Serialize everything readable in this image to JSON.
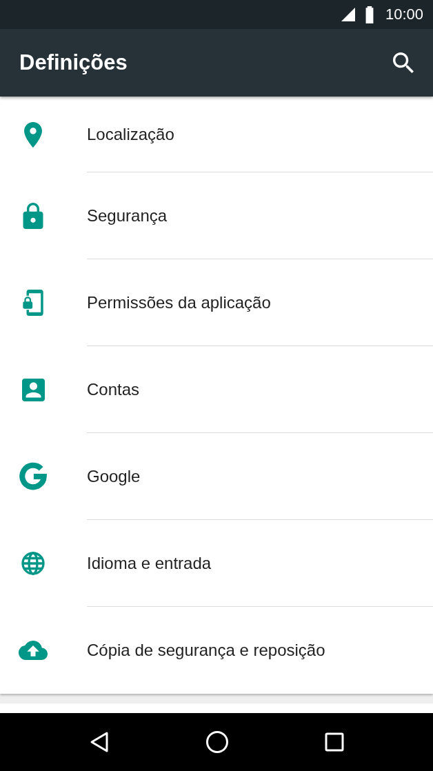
{
  "status_bar": {
    "time": "10:00"
  },
  "app_bar": {
    "title": "Definições"
  },
  "items": [
    {
      "label": "Localização"
    },
    {
      "label": "Segurança"
    },
    {
      "label": "Permissões da aplicação"
    },
    {
      "label": "Contas"
    },
    {
      "label": "Google"
    },
    {
      "label": "Idioma e entrada"
    },
    {
      "label": "Cópia de segurança e reposição"
    }
  ]
}
